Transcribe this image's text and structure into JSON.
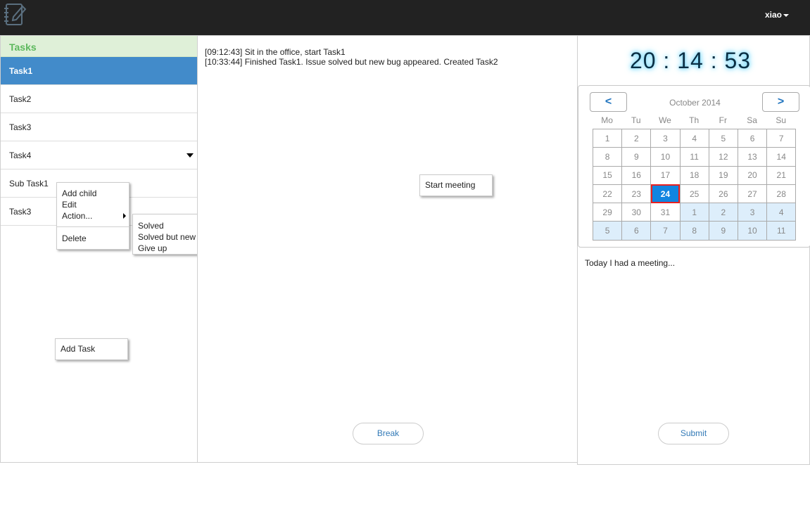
{
  "header": {
    "user_label": "xiao"
  },
  "sidebar": {
    "title": "Tasks",
    "items": [
      {
        "label": "Task1"
      },
      {
        "label": "Task2"
      },
      {
        "label": "Task3"
      },
      {
        "label": "Task4"
      },
      {
        "label": "Sub Task1"
      },
      {
        "label": "Task3"
      }
    ],
    "add_task_label": "Add Task"
  },
  "context_menu": {
    "add_child": "Add child",
    "edit": "Edit",
    "action": "Action...",
    "delete": "Delete"
  },
  "action_submenu": {
    "solved": "Solved",
    "solved_new_issue": "Solved but new issue",
    "give_up": "Give up"
  },
  "log": {
    "lines": [
      "[09:12:43] Sit in the office, start Task1",
      "[10:33:44] Finished Task1. Issue solved but new bug appeared. Created Task2"
    ],
    "start_meeting_label": "Start meeting",
    "break_label": "Break"
  },
  "clock": {
    "text": "20 : 14 : 53"
  },
  "calendar": {
    "title": "October 2014",
    "prev_label": "<",
    "next_label": ">",
    "weekdays": [
      "Mo",
      "Tu",
      "We",
      "Th",
      "Fr",
      "Sa",
      "Su"
    ],
    "weeks": [
      [
        "1",
        "2",
        "3",
        "4",
        "5",
        "6",
        "7"
      ],
      [
        "8",
        "9",
        "10",
        "11",
        "12",
        "13",
        "14"
      ],
      [
        "15",
        "16",
        "17",
        "18",
        "19",
        "20",
        "21"
      ],
      [
        "22",
        "23",
        "24",
        "25",
        "26",
        "27",
        "28"
      ],
      [
        "29",
        "30",
        "31",
        "1",
        "2",
        "3",
        "4"
      ],
      [
        "5",
        "6",
        "7",
        "8",
        "9",
        "10",
        "11"
      ]
    ],
    "selected_day": "24",
    "colors": {
      "today_bg": "#1185e0",
      "today_border": "#e82020",
      "other_month_bg": "#ddeefb"
    }
  },
  "notes": {
    "text": "Today I had a meeting...",
    "submit_label": "Submit"
  },
  "colors": {
    "topbar": "#222222",
    "sidebar_header_bg": "#dff0d8",
    "sidebar_header_text": "#5cb85c",
    "active_item_bg": "#428bca",
    "link_blue": "#337ab7"
  },
  "icons": {
    "logo": "notebook-pencil-icon",
    "user_caret": "caret-down-icon",
    "task4_expand": "triangle-down-icon",
    "action_submenu": "triangle-right-icon"
  }
}
